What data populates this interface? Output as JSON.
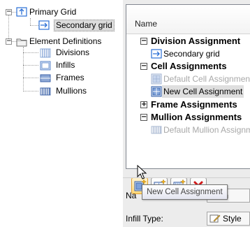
{
  "tree": {
    "items": [
      {
        "label": "Primary Grid",
        "icon": "primary-grid-icon",
        "expander": "−"
      },
      {
        "label": "Secondary grid",
        "icon": "secondary-grid-icon",
        "selected": true
      },
      {
        "label": "Element Definitions",
        "icon": "folder-icon",
        "expander": "−"
      },
      {
        "label": "Divisions",
        "icon": "divisions-icon"
      },
      {
        "label": "Infills",
        "icon": "infills-icon"
      },
      {
        "label": "Frames",
        "icon": "frames-icon"
      },
      {
        "label": "Mullions",
        "icon": "mullions-icon"
      }
    ]
  },
  "assignments": {
    "column_header": "Name",
    "groups": [
      {
        "label": "Division Assignment",
        "toggle": "−",
        "items": [
          {
            "label": "Secondary grid",
            "icon": "secondary-grid-icon",
            "disabled": false
          }
        ]
      },
      {
        "label": "Cell Assignments",
        "toggle": "−",
        "items": [
          {
            "label": "Default Cell Assignment",
            "icon": "cell-assignment-icon",
            "disabled": true
          },
          {
            "label": "New Cell Assignment",
            "icon": "cell-assignment-icon",
            "disabled": false,
            "selected": true
          }
        ]
      },
      {
        "label": "Frame Assignments",
        "toggle": "+",
        "items": []
      },
      {
        "label": "Mullion Assignments",
        "toggle": "−",
        "items": [
          {
            "label": "Default Mullion Assignment",
            "icon": "mullion-assignment-icon",
            "disabled": true
          }
        ]
      }
    ]
  },
  "toolbar": {
    "buttons": [
      {
        "name": "new-cell-assignment-button",
        "icon": "new-cell-assignment-icon"
      },
      {
        "name": "new-frame-assignment-button",
        "icon": "new-frame-assignment-icon"
      },
      {
        "name": "new-mullion-assignment-button",
        "icon": "new-mullion-assignment-icon"
      },
      {
        "name": "delete-button",
        "icon": "delete-icon"
      }
    ],
    "tooltip": "New Cell Assignment"
  },
  "properties": {
    "name_label": "Na",
    "name_value": "ult In",
    "infill_type_label": "Infill Type:",
    "infill_type_value": "Style"
  },
  "colors": {
    "accent_blue": "#2a6fd6",
    "selection": "#dcdcdc",
    "delete_red": "#d01818"
  }
}
